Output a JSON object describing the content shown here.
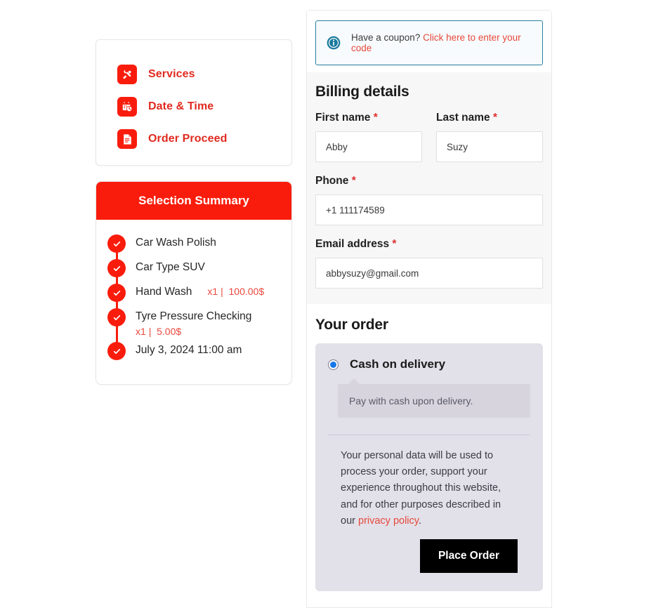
{
  "steps": {
    "items": [
      {
        "label": "Services",
        "icon": "tools-icon"
      },
      {
        "label": "Date & Time",
        "icon": "calendar-clock-icon"
      },
      {
        "label": "Order Proceed",
        "icon": "document-icon"
      }
    ]
  },
  "summary": {
    "title": "Selection Summary",
    "items": [
      {
        "name": "Car Wash Polish",
        "qty": "",
        "price": ""
      },
      {
        "name": "Car Type SUV",
        "qty": "",
        "price": ""
      },
      {
        "name": "Hand Wash",
        "qty": "x1",
        "sep": "|",
        "price": "100.00$"
      },
      {
        "name": "Tyre Pressure Checking",
        "qty": "x1",
        "sep": "|",
        "price": "5.00$"
      },
      {
        "name": "July 3, 2024 11:00 am",
        "qty": "",
        "price": ""
      }
    ]
  },
  "coupon": {
    "icon": "info-icon",
    "text": "Have a coupon?",
    "link_label": "Click here to enter your code"
  },
  "billing": {
    "title": "Billing details",
    "first_name": {
      "label": "First name",
      "required": "*",
      "value": "Abby",
      "placeholder": "First name"
    },
    "last_name": {
      "label": "Last name",
      "required": "*",
      "value": "Suzy",
      "placeholder": "Last name"
    },
    "phone": {
      "label": "Phone",
      "required": "*",
      "value": "+1 111174589",
      "placeholder": "Phone"
    },
    "email": {
      "label": "Email address",
      "required": "*",
      "value": "abbysuzy@gmail.com",
      "placeholder": "Email address"
    }
  },
  "order": {
    "title": "Your order",
    "payment": {
      "selected_label": "Cash on delivery",
      "description": "Pay with cash upon delivery."
    },
    "privacy_text_before": "Your personal data will be used to process your order, support your experience throughout this website, and for other purposes described in our ",
    "privacy_link": "privacy policy",
    "privacy_text_after": ".",
    "place_order_label": "Place Order"
  },
  "colors": {
    "brand_red": "#f91c0c",
    "link_red": "#e8483c",
    "info_blue": "#2a7f9e",
    "radio_blue": "#1778e8",
    "button_black": "#000000"
  }
}
